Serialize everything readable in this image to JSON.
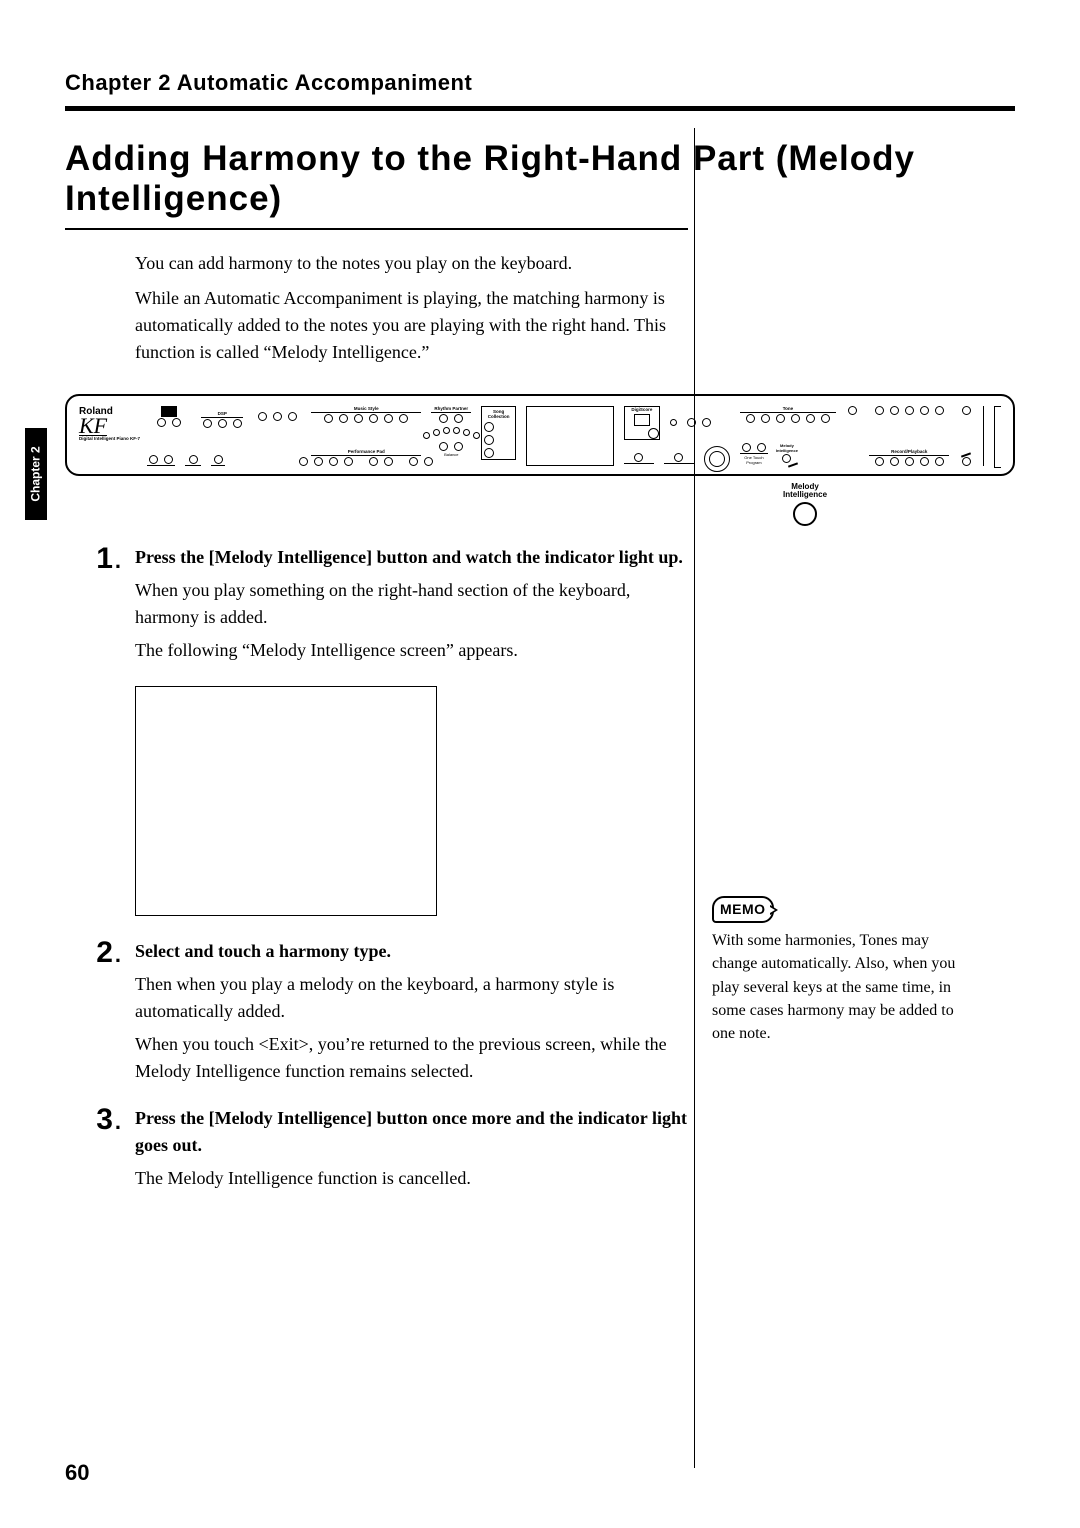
{
  "header": {
    "chapter": "Chapter 2  Automatic Accompaniment"
  },
  "sideTab": "Chapter 2",
  "title": "Adding Harmony to the Right-Hand Part (Melody Intelligence)",
  "intro": {
    "p1": "You can add harmony to the notes you play on the keyboard.",
    "p2": "While an Automatic Accompaniment is playing, the matching harmony is automatically added to the notes you are playing with the right hand. This function is called “Melody Intelligence.”"
  },
  "panel": {
    "brand": "Roland",
    "model": "KF",
    "subModel": "Digital Intelligent Piano  KF-7",
    "sections": {
      "dsp": "DSP",
      "musicStyle": "Music Style",
      "rhythmPartner": "Rhythm Partner",
      "performancePad": "Performance Pad",
      "balance": "Balance",
      "songCollection": "Song Collection",
      "digiScore": "DigiScore",
      "tone": "Tone",
      "recordPlayback": "Record/Playback",
      "oneTouch": "One Touch Program",
      "melodyIntel": "Melody Intelligence"
    },
    "calloutLabel1": "Melody",
    "calloutLabel2": "Intelligence"
  },
  "steps": {
    "s1": {
      "num": "1",
      "instr": "Press the [Melody Intelligence] button and watch the indicator light up.",
      "body1": "When you play something on the right-hand section of the keyboard, harmony is added.",
      "body2": "The following “Melody Intelligence screen” appears."
    },
    "s2": {
      "num": "2",
      "instr": "Select and touch a harmony type.",
      "body1": "Then when you play a melody on the keyboard, a harmony style is automatically added.",
      "body2": "When you touch <Exit>, you’re returned to the previous screen, while the Melody Intelligence function remains selected."
    },
    "s3": {
      "num": "3",
      "instr": "Press the [Melody Intelligence] button once more and the indicator light goes out.",
      "body1": "The Melody Intelligence function is cancelled."
    }
  },
  "memo": {
    "label": "MEMO",
    "text": "With some harmonies, Tones may change automatically. Also, when you play several keys at the same time, in some cases harmony may be added to one note."
  },
  "pageNumber": "60"
}
